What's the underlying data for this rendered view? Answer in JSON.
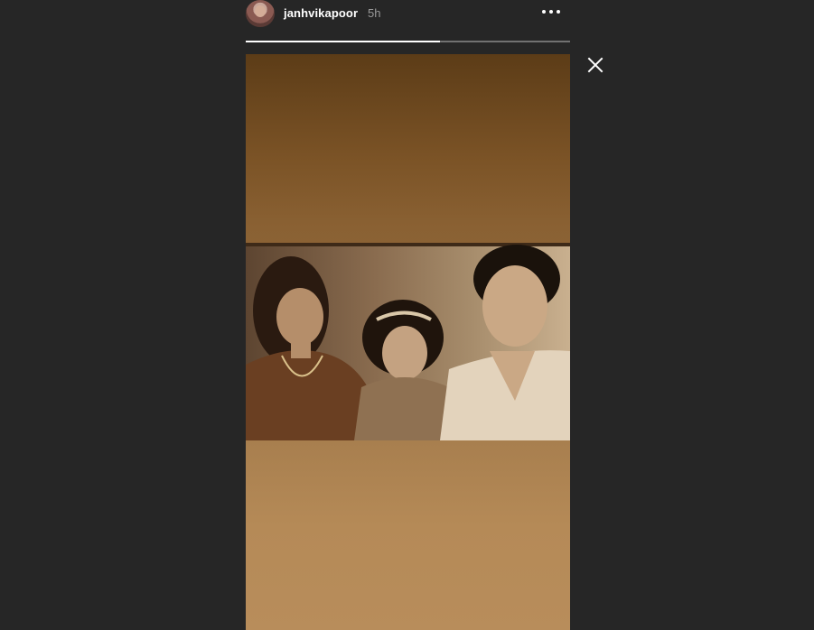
{
  "story": {
    "username": "janhvikapoor",
    "time": "5h",
    "progress": 0.6
  },
  "icons": {
    "avatar": "profile-avatar",
    "more": "more-horizontal-icon",
    "close": "close-icon"
  },
  "colors": {
    "background": "#262626",
    "text": "#ffffff",
    "muted": "#9a9a9a"
  }
}
